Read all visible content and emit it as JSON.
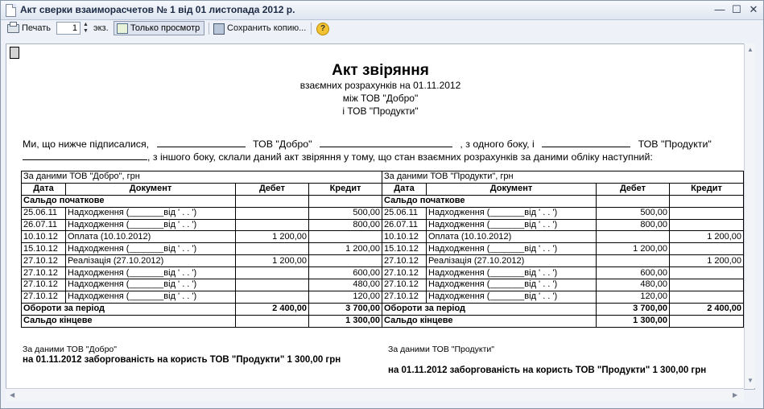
{
  "window": {
    "title": "Акт сверки взаиморасчетов № 1 від 01 листопада 2012 р."
  },
  "toolbar": {
    "print_label": "Печать",
    "copies_value": "1",
    "copies_unit": "экз.",
    "view_only_label": "Только просмотр",
    "save_copy_label": "Сохранить копию...",
    "help_symbol": "?"
  },
  "doc": {
    "title": "Акт звіряння",
    "subtitle": "взаємних розрахунків на 01.11.2012",
    "between": "між ТОВ \"Добро\"",
    "and": "і ТОВ \"Продукти\"",
    "p1a": "Ми, що нижче підписалися,",
    "p1b": "ТОВ \"Добро\"",
    "p1c": ", з одного боку, і",
    "p1d": "ТОВ \"Продукти\"",
    "p2": ", з іншого боку, склали даний акт звіряння у тому, що стан взаємних розрахунків за даними обліку наступний:"
  },
  "table": {
    "left_header": "За даними ТОВ \"Добро\", грн",
    "right_header": "За даними ТОВ \"Продукти\", грн",
    "cols": [
      "Дата",
      "Документ",
      "Дебет",
      "Кредит"
    ],
    "opening": "Сальдо початкове",
    "rows": [
      {
        "l_date": "25.06.11",
        "l_doc": "Надходження (_______від ' .  . ')",
        "l_debit": "",
        "l_credit": "500,00",
        "r_date": "25.06.11",
        "r_doc": "Надходження (_______від ' .  . ')",
        "r_debit": "500,00",
        "r_credit": ""
      },
      {
        "l_date": "26.07.11",
        "l_doc": "Надходження (_______від ' .  . ')",
        "l_debit": "",
        "l_credit": "800,00",
        "r_date": "26.07.11",
        "r_doc": "Надходження (_______від ' .  . ')",
        "r_debit": "800,00",
        "r_credit": ""
      },
      {
        "l_date": "10.10.12",
        "l_doc": "Оплата (10.10.2012)",
        "l_debit": "1 200,00",
        "l_credit": "",
        "r_date": "10.10.12",
        "r_doc": "Оплата (10.10.2012)",
        "r_debit": "",
        "r_credit": "1 200,00"
      },
      {
        "l_date": "15.10.12",
        "l_doc": "Надходження (_______від ' .  . ')",
        "l_debit": "",
        "l_credit": "1 200,00",
        "r_date": "15.10.12",
        "r_doc": "Надходження (_______від ' .  . ')",
        "r_debit": "1 200,00",
        "r_credit": ""
      },
      {
        "l_date": "27.10.12",
        "l_doc": "Реалізація (27.10.2012)",
        "l_debit": "1 200,00",
        "l_credit": "",
        "r_date": "27.10.12",
        "r_doc": "Реалізація (27.10.2012)",
        "r_debit": "",
        "r_credit": "1 200,00"
      },
      {
        "l_date": "27.10.12",
        "l_doc": "Надходження (_______від ' .  . ')",
        "l_debit": "",
        "l_credit": "600,00",
        "r_date": "27.10.12",
        "r_doc": "Надходження (_______від ' .  . ')",
        "r_debit": "600,00",
        "r_credit": ""
      },
      {
        "l_date": "27.10.12",
        "l_doc": "Надходження (_______від ' .  . ')",
        "l_debit": "",
        "l_credit": "480,00",
        "r_date": "27.10.12",
        "r_doc": "Надходження (_______від ' .  . ')",
        "r_debit": "480,00",
        "r_credit": ""
      },
      {
        "l_date": "27.10.12",
        "l_doc": "Надходження (_______від ' .  . ')",
        "l_debit": "",
        "l_credit": "120,00",
        "r_date": "27.10.12",
        "r_doc": "Надходження (_______від ' .  . ')",
        "r_debit": "120,00",
        "r_credit": ""
      }
    ],
    "turnover_label": "Обороти за період",
    "turnover": {
      "l_debit": "2 400,00",
      "l_credit": "3 700,00",
      "r_debit": "3 700,00",
      "r_credit": "2 400,00"
    },
    "closing_label": "Сальдо кінцеве",
    "closing": {
      "l_debit": "",
      "l_credit": "1 300,00",
      "r_debit": "1 300,00",
      "r_credit": ""
    }
  },
  "footer": {
    "left_label": "За даними ТОВ \"Добро\"",
    "left_text": "на 01.11.2012 заборгованість на користь  ТОВ \"Продукти\" 1 300,00 грн",
    "right_label": "За даними ТОВ \"Продукти\"",
    "right_text": "на 01.11.2012 заборгованість на користь  ТОВ \"Продукти\" 1 300,00 грн"
  }
}
